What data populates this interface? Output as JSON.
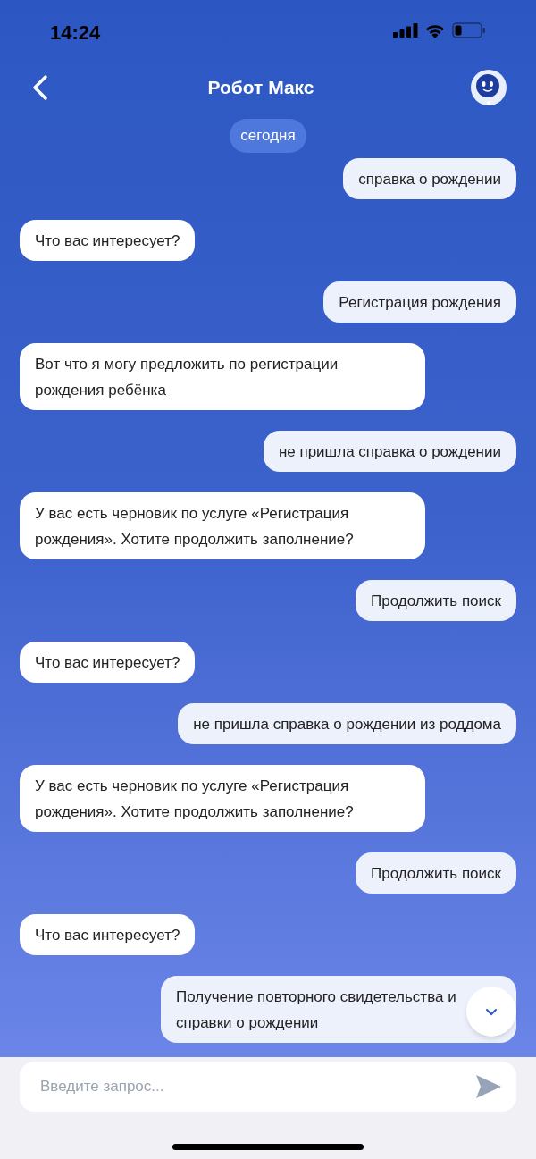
{
  "status_bar": {
    "time": "14:24"
  },
  "header": {
    "title": "Робот Макс"
  },
  "date_chip": "сегодня",
  "messages": [
    {
      "outgoing": true,
      "text": "справка о рождении"
    },
    {
      "outgoing": false,
      "text": "Что вас интересует?"
    },
    {
      "outgoing": true,
      "text": "Регистрация рождения"
    },
    {
      "outgoing": false,
      "text": "Вот что я могу предложить по регистрации рождения ребёнка"
    },
    {
      "outgoing": true,
      "text": "не пришла справка о рождении"
    },
    {
      "outgoing": false,
      "text": "У вас есть черновик по услуге «Регистрация рождения». Хотите продолжить заполнение?"
    },
    {
      "outgoing": true,
      "text": "Продолжить поиск"
    },
    {
      "outgoing": false,
      "text": "Что вас интересует?"
    },
    {
      "outgoing": true,
      "text": "не пришла справка о рождении из роддома"
    },
    {
      "outgoing": false,
      "text": "У вас есть черновик по услуге «Регистрация рождения». Хотите продолжить заполнение?"
    },
    {
      "outgoing": true,
      "text": "Продолжить поиск"
    },
    {
      "outgoing": false,
      "text": "Что вас интересует?"
    },
    {
      "outgoing": true,
      "text": "Получение повторного свидетельства и справки о рождении"
    }
  ],
  "input": {
    "placeholder": "Введите запрос..."
  }
}
